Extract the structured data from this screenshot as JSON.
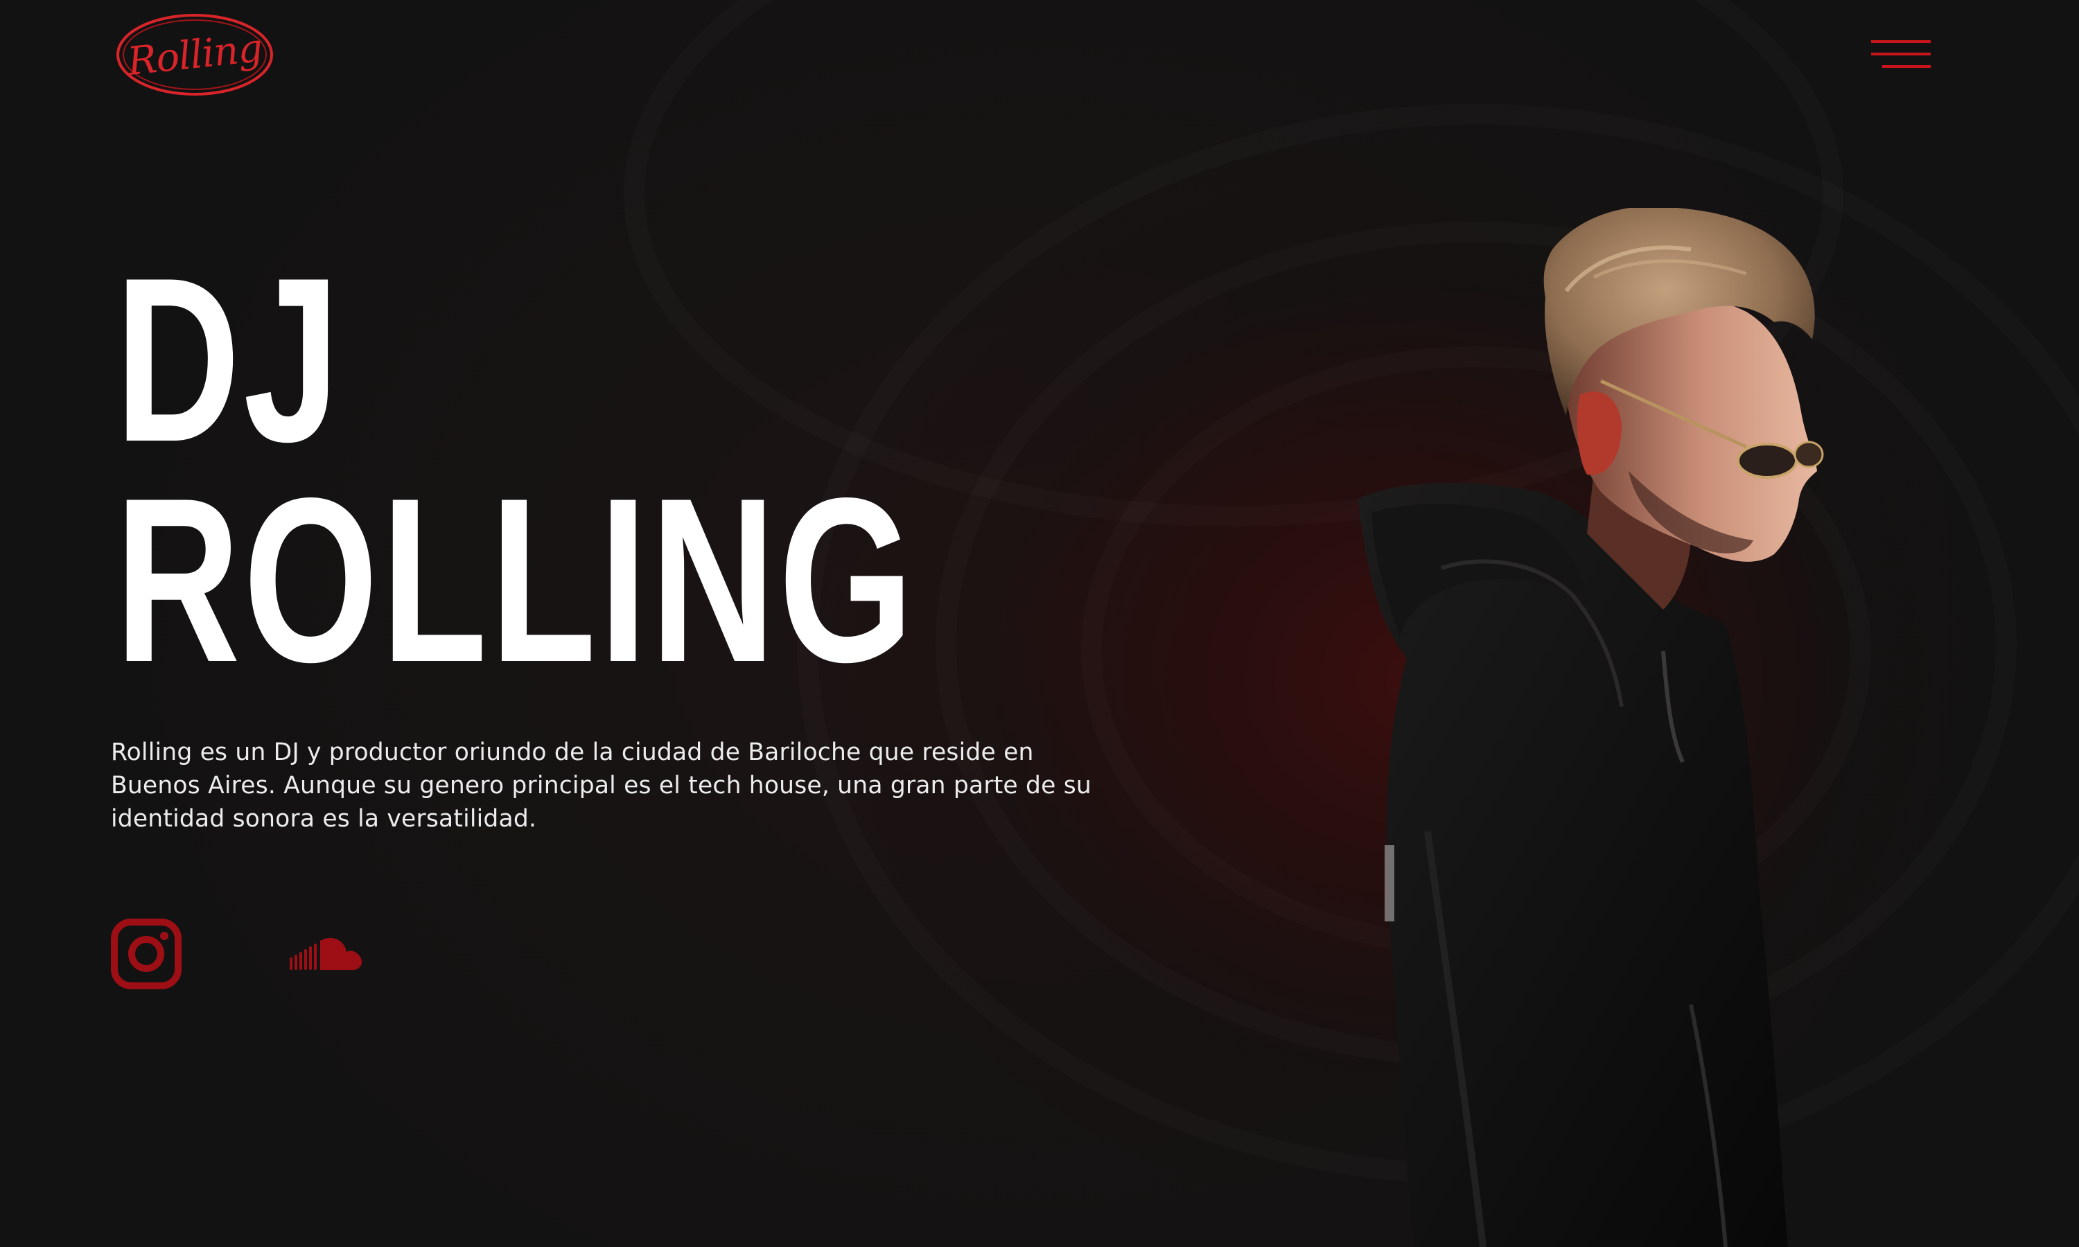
{
  "brand": {
    "logo_text": "Rolling",
    "accent_color": "#c8141b"
  },
  "nav": {
    "menu_icon": "hamburger-menu-icon"
  },
  "hero": {
    "title_line1": "DJ",
    "title_line2": "ROLLING",
    "description": "Rolling es un DJ y productor oriundo de la ciudad de Bariloche que reside en Buenos Aires. Aunque su genero principal es el tech house, una gran parte de su identidad sonora es la versatilidad."
  },
  "social": {
    "icons": [
      "instagram-icon",
      "soundcloud-icon"
    ]
  },
  "image": {
    "subject": "dj-portrait-image"
  }
}
